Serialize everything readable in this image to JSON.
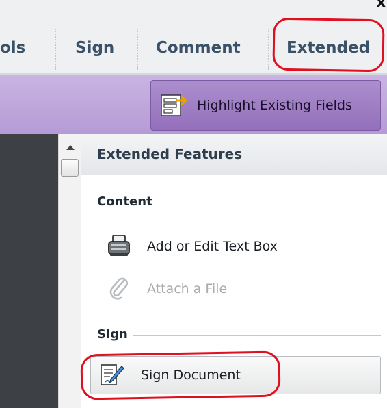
{
  "tabs": [
    {
      "label": "ols"
    },
    {
      "label": "Sign"
    },
    {
      "label": "Comment"
    },
    {
      "label": "Extended"
    }
  ],
  "close_symbol": "x",
  "toolbar": {
    "highlight_button_label": "Highlight Existing Fields",
    "highlight_icon": "highlight-fields-icon"
  },
  "panel": {
    "title": "Extended Features",
    "sections": [
      {
        "label": "Content",
        "items": [
          {
            "label": "Add or Edit Text Box",
            "icon": "typewriter-icon",
            "enabled": true
          },
          {
            "label": "Attach a File",
            "icon": "paperclip-icon",
            "enabled": false
          }
        ]
      },
      {
        "label": "Sign",
        "items": [
          {
            "label": "Sign Document",
            "icon": "sign-document-icon",
            "enabled": true
          }
        ]
      }
    ]
  },
  "colors": {
    "toolbar_purple": "#b59bd6",
    "annotation_red": "#e01021",
    "tab_text": "#3a5168"
  }
}
